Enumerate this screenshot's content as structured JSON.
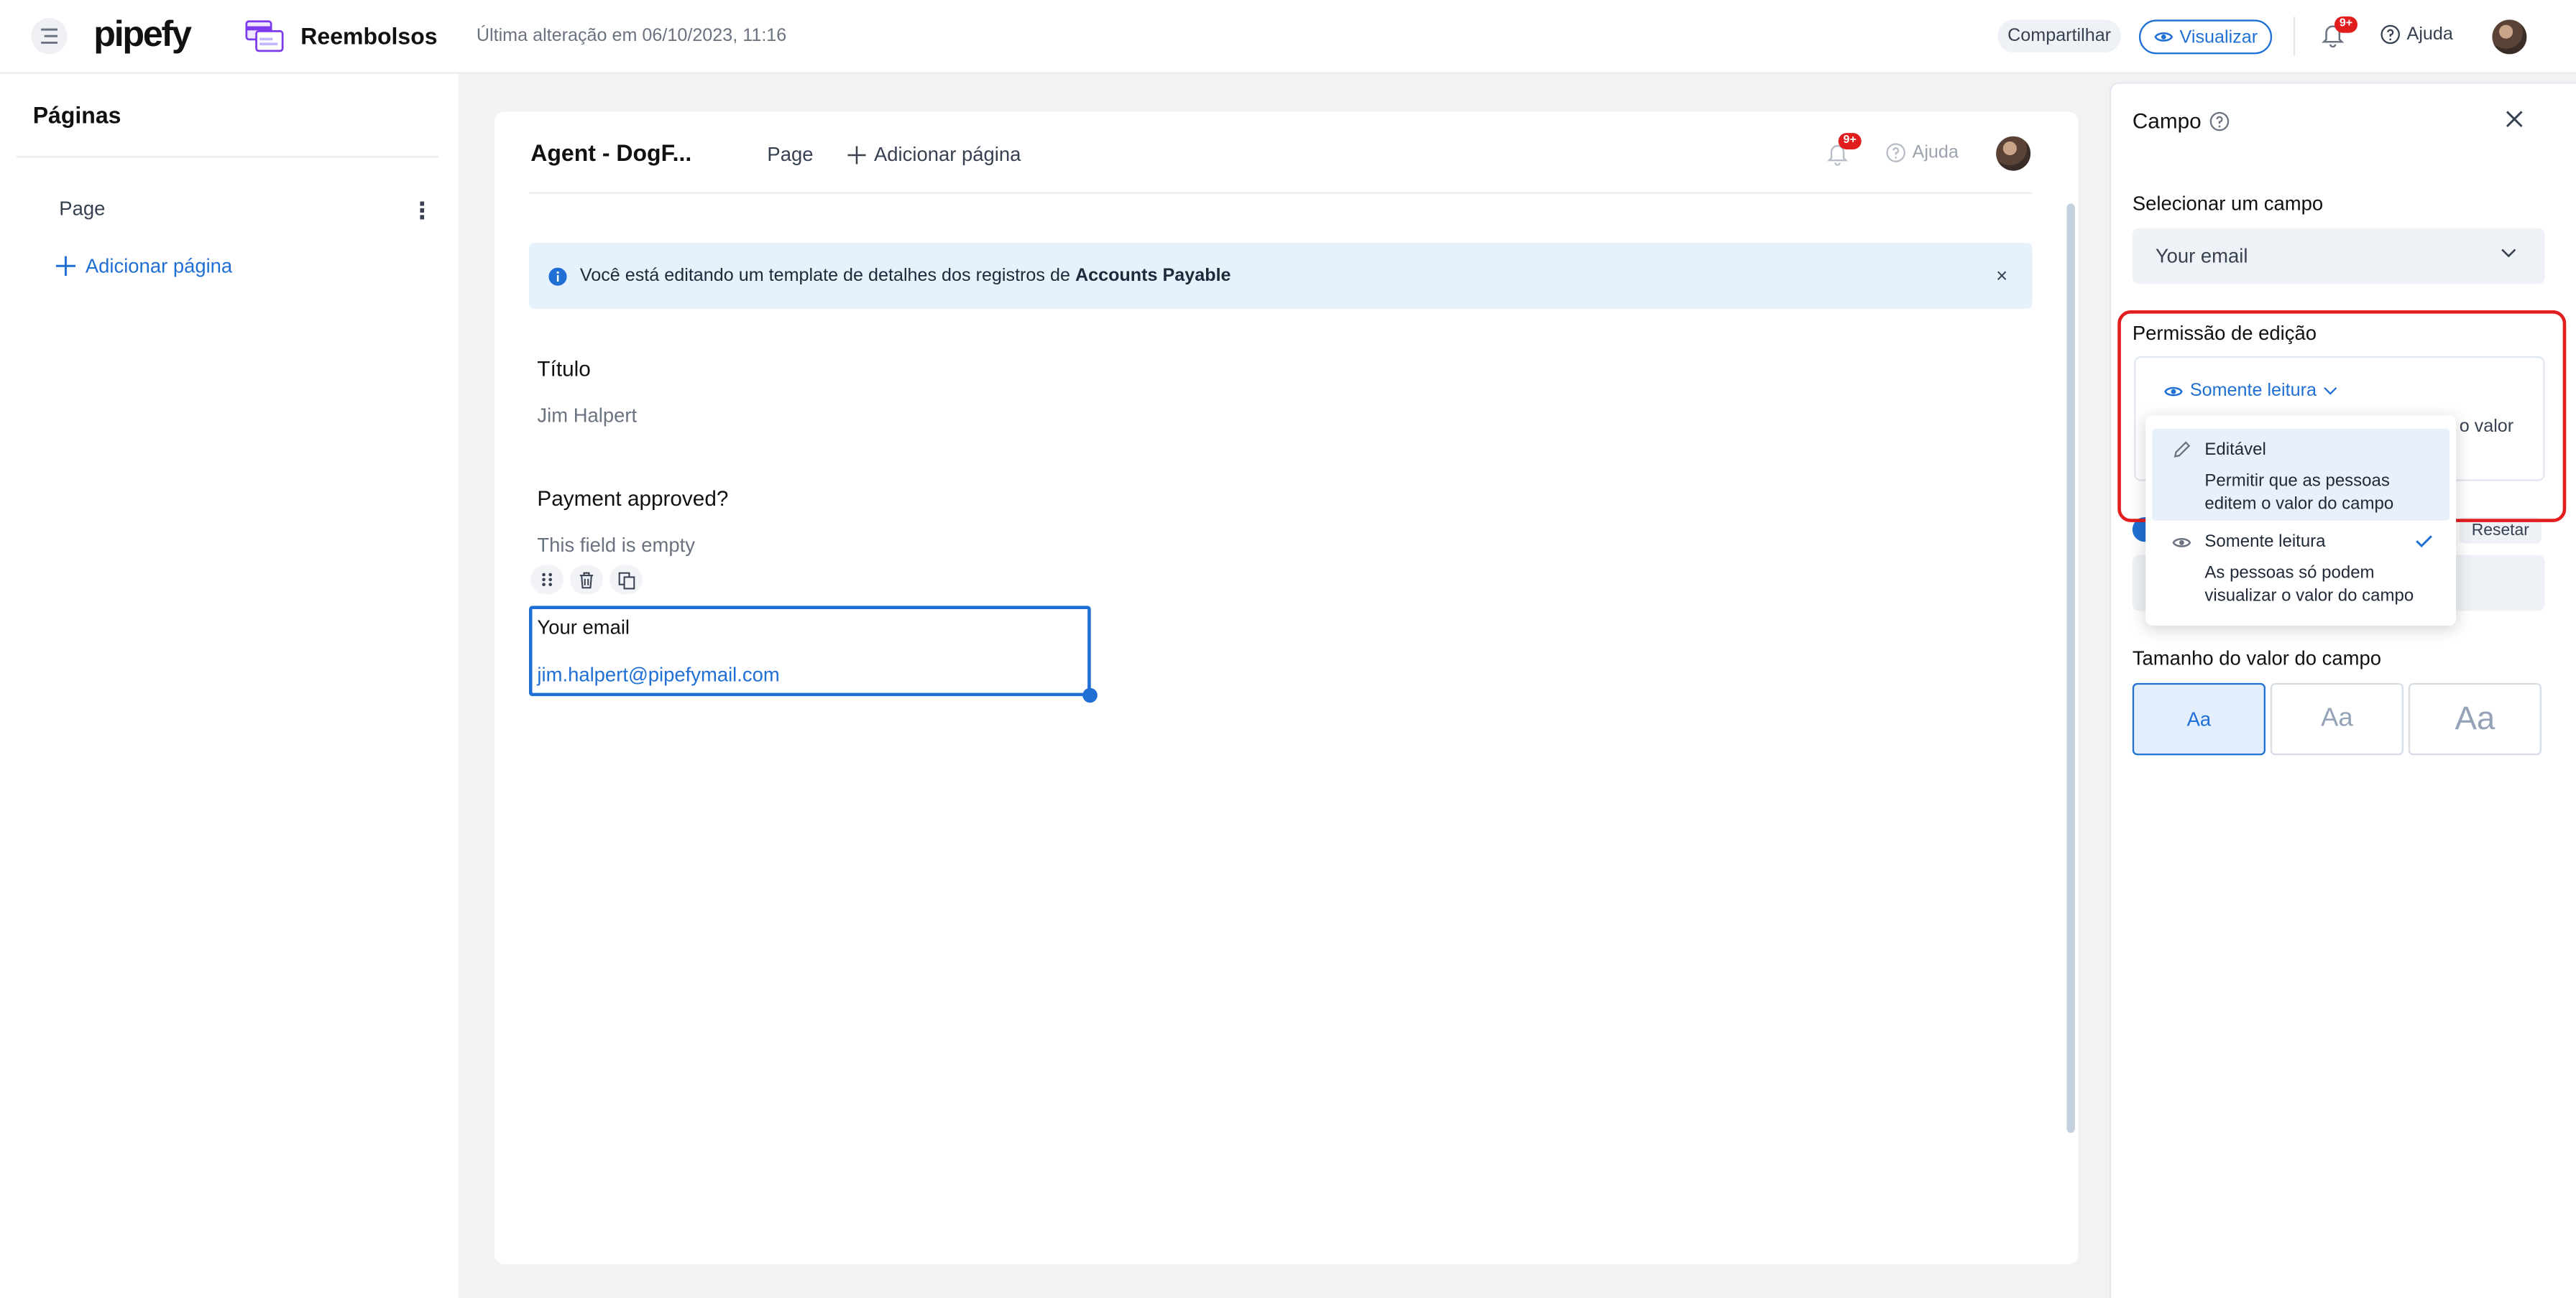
{
  "topbar": {
    "logo": "pipefy",
    "app_name": "Reembolsos",
    "last_change": "Última alteração em 06/10/2023, 11:16",
    "share_label": "Compartilhar",
    "view_label": "Visualizar",
    "notif_badge": "9+",
    "help_label": "Ajuda"
  },
  "sidebar": {
    "title": "Páginas",
    "pages": [
      "Page"
    ],
    "add_page_label": "Adicionar página"
  },
  "card": {
    "title": "Agent - DogF...",
    "tab_page": "Page",
    "add_page_label": "Adicionar página",
    "notif_badge": "9+",
    "help_label": "Ajuda",
    "info_prefix": "Você está editando um template de detalhes dos registros de",
    "info_bold": "Accounts Payable",
    "info_close": "×",
    "fields": [
      {
        "label": "Título",
        "value": "Jim Halpert"
      },
      {
        "label": "Payment approved?",
        "value": "This field is empty"
      }
    ],
    "selected_field": {
      "label": "Your email",
      "value": "jim.halpert@pipefymail.com"
    }
  },
  "panel": {
    "title": "Campo",
    "select_label": "Selecionar um campo",
    "select_value": "Your email",
    "permission_label": "Permissão de edição",
    "permission_selected": "Somente leitura",
    "permission_peek_text": "o valor",
    "reset_label": "Resetar",
    "options": [
      {
        "title": "Editável",
        "desc": "Permitir que as pessoas editem o valor do campo"
      },
      {
        "title": "Somente leitura",
        "desc": "As pessoas só podem visualizar o valor do campo"
      }
    ],
    "size_label": "Tamanho do valor do campo",
    "sizes": [
      "Aa",
      "Aa",
      "Aa"
    ]
  },
  "colors": {
    "accent": "#1f6fd4",
    "highlight_border": "#e11d1d",
    "info_bg": "#e5f1fc"
  }
}
